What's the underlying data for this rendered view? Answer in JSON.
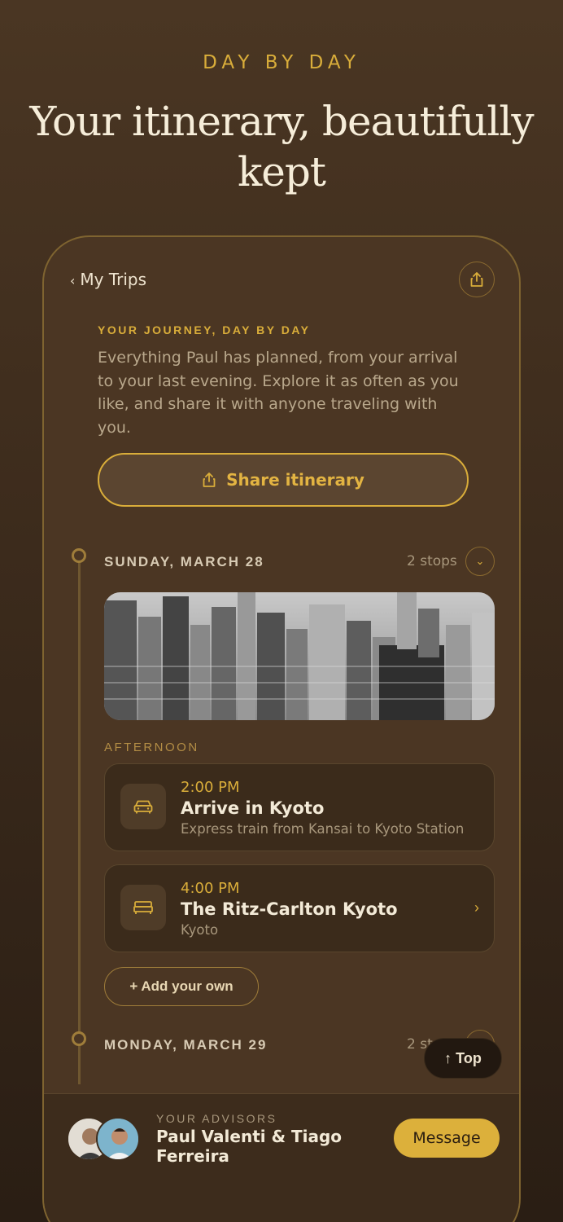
{
  "hero": {
    "eyebrow": "DAY BY DAY",
    "headline": "Your itinerary, beautifully kept"
  },
  "nav": {
    "back_label": "My Trips",
    "share_icon": "share-icon"
  },
  "intro": {
    "eyebrow": "YOUR JOURNEY, DAY BY DAY",
    "body": "Everything Paul has planned, from your arrival to your last evening. Explore it as often as you like, and share it with anyone traveling with you.",
    "share_button": "Share itinerary"
  },
  "days": [
    {
      "label": "SUNDAY, MARCH 28",
      "stops_count": "2 stops",
      "photo": "city-skyline-photo",
      "period": "AFTERNOON",
      "stops": [
        {
          "time": "2:00 PM",
          "title": "Arrive in Kyoto",
          "subtitle": "Express train from Kansai to Kyoto Station",
          "icon": "car-icon"
        },
        {
          "time": "4:00 PM",
          "title": "The Ritz-Carlton Kyoto",
          "subtitle": "Kyoto",
          "icon": "bed-icon"
        }
      ],
      "add_button": "+ Add your own"
    },
    {
      "label": "MONDAY, MARCH 29",
      "stops_count": "2 stops"
    }
  ],
  "top_button": "↑ Top",
  "advisors": {
    "eyebrow": "YOUR ADVISORS",
    "names": "Paul Valenti & Tiago Ferreira",
    "message_button": "Message"
  },
  "colors": {
    "accent": "#d9ad3a",
    "background": "#4b3623",
    "card": "#3b2b1b"
  }
}
